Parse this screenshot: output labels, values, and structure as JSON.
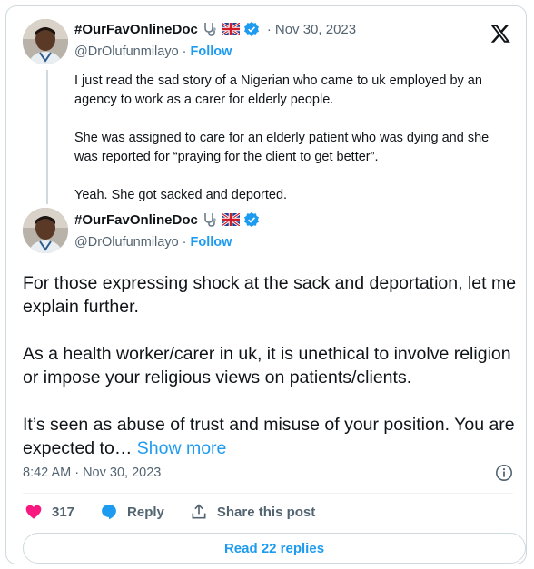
{
  "parent_tweet": {
    "display_name": "#OurFavOnlineDoc",
    "handle": "@DrOlufunmilayo",
    "follow_label": "Follow",
    "date": "Nov 30, 2023",
    "separator": "·",
    "paragraphs": [
      "I just read the sad story of a Nigerian who came to uk employed by an agency to work as a carer for elderly people.",
      "She was assigned to care for an elderly patient who was dying and she was reported for “praying for the client to get better”.",
      "Yeah. She got sacked and deported."
    ]
  },
  "main_tweet": {
    "display_name": "#OurFavOnlineDoc",
    "handle": "@DrOlufunmilayo",
    "follow_label": "Follow",
    "separator": "·",
    "paragraphs": [
      "For those expressing shock at the sack and deportation, let me explain further.",
      "As a health worker/carer in uk, it is unethical to involve religion or impose your religious views on patients/clients."
    ],
    "last_paragraph": "It’s seen as abuse of trust and misuse of your position. You are expected to…",
    "show_more_label": "Show more",
    "timestamp": "8:42 AM · Nov 30, 2023"
  },
  "actions": {
    "like_count": "317",
    "reply_label": "Reply",
    "share_label": "Share this post"
  },
  "read_replies_label": "Read 22 replies",
  "icons": {
    "logo": "x-logo-icon",
    "stethoscope": "stethoscope-icon",
    "flag": "uk-flag-icon",
    "verified": "verified-badge-icon",
    "like": "heart-icon",
    "reply": "speech-bubble-icon",
    "share": "share-icon",
    "info": "info-icon"
  },
  "colors": {
    "accent": "#1d9bf0",
    "like": "#f91880",
    "text": "#0f1419",
    "muted": "#536471",
    "border": "#cfd9de"
  }
}
